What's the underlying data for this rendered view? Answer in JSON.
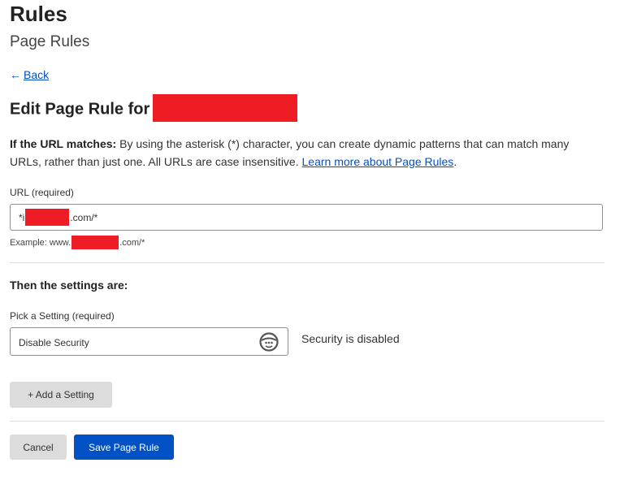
{
  "header": {
    "title": "Rules",
    "subtitle": "Page Rules"
  },
  "back": {
    "arrow": "←",
    "label": "Back"
  },
  "edit": {
    "heading": "Edit Page Rule for"
  },
  "description": {
    "lead": "If the URL matches:",
    "body": " By using the asterisk (*) character, you can create dynamic patterns that can match many URLs, rather than just one. All URLs are case insensitive. ",
    "link": "Learn more about Page Rules",
    "end": "."
  },
  "url_field": {
    "label": "URL (required)",
    "value_prefix": "*i",
    "value_suffix": ".com/*",
    "example_prefix": "Example: www.",
    "example_suffix": ".com/*"
  },
  "settings": {
    "heading": "Then the settings are:",
    "pick_label": "Pick a Setting (required)",
    "selected": "Disable Security",
    "value_text": "Security is disabled"
  },
  "buttons": {
    "add": "+ Add a Setting",
    "cancel": "Cancel",
    "save": "Save Page Rule"
  },
  "colors": {
    "accent": "#0051c3",
    "redaction": "#ee1c25",
    "button_secondary": "#dcdcdc"
  },
  "icons": {
    "select": "circle-ellipsis-icon"
  }
}
